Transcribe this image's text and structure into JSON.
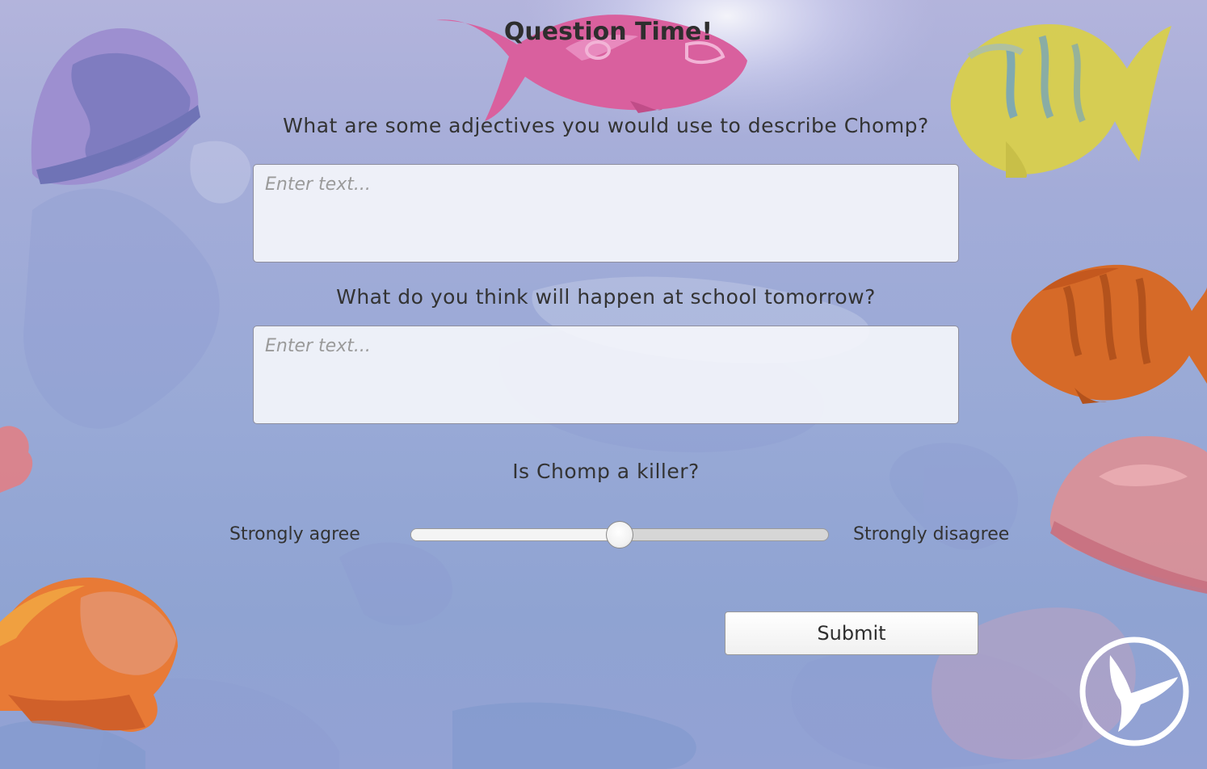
{
  "page": {
    "title": "Question Time!",
    "background_color": "#9fabd7"
  },
  "questions": [
    {
      "label": "What are some adjectives you would use to describe Chomp?",
      "value": "",
      "placeholder": "Enter text..."
    },
    {
      "label": "What do you think will happen at school tomorrow?",
      "value": "",
      "placeholder": "Enter text..."
    }
  ],
  "scale_question": {
    "label": "Is Chomp a killer?",
    "left_label": "Strongly agree",
    "right_label": "Strongly disagree",
    "value_fraction": 0.5
  },
  "submit": {
    "label": "Submit"
  },
  "decorations": {
    "icons": [
      "jellyfish-purple-icon",
      "fish-pink-icon",
      "fish-yellow-icon",
      "fish-orange-icon",
      "jellyfish-pink-icon",
      "jellyfish-orange-icon",
      "plane-logo-icon"
    ],
    "colors": {
      "pink_fish": "#d95a9a",
      "yellow_fish": "#d6cc4e",
      "orange_fish": "#d9692a",
      "purple_jellyfish": "#8a84c4",
      "pink_jellyfish": "#d9899a",
      "orange_jellyfish": "#e5743a"
    }
  }
}
